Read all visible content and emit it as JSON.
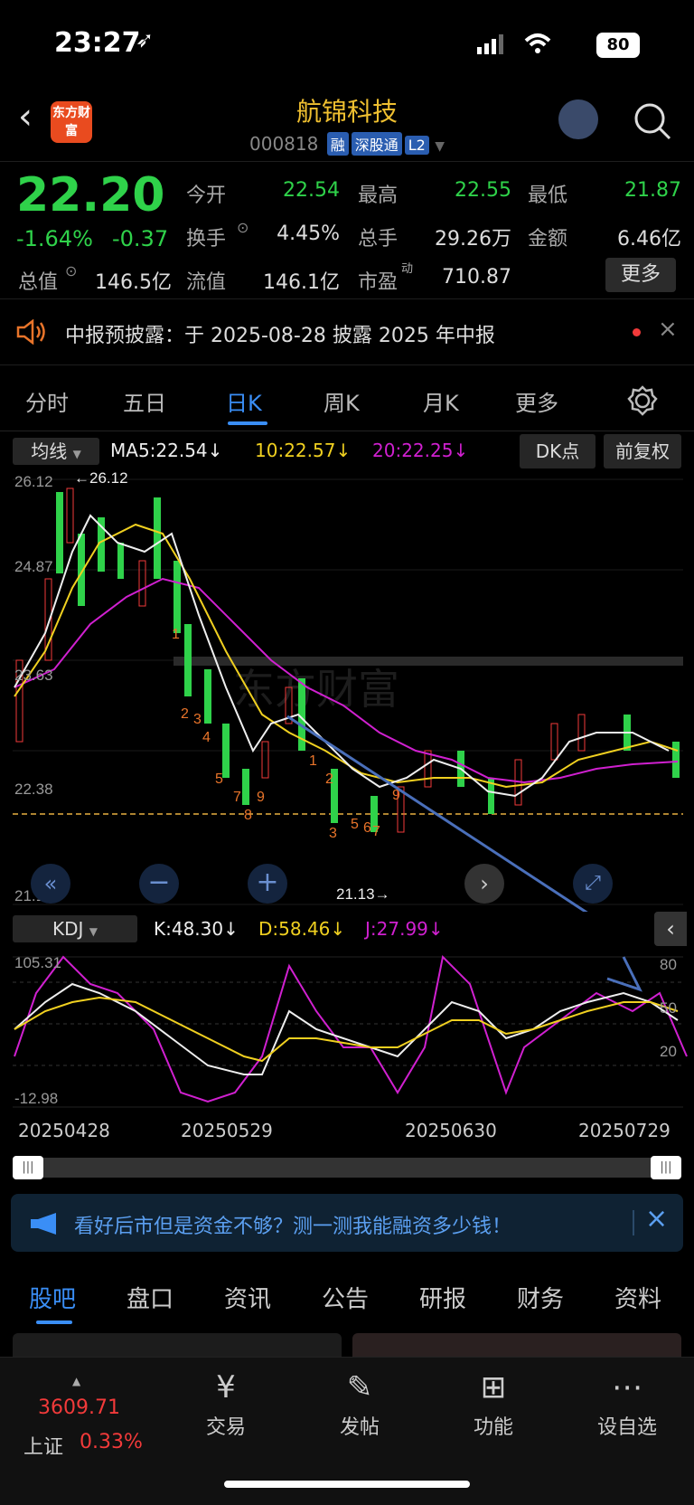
{
  "status": {
    "time": "23:27",
    "battery": "80"
  },
  "header": {
    "logo_text": "东方财富",
    "title": "航锦科技",
    "code": "000818",
    "tags": [
      "融",
      "深股通",
      "L2"
    ]
  },
  "quote": {
    "price": "22.20",
    "change_pct": "-1.64%",
    "change_abs": "-0.37",
    "fields": [
      {
        "label": "今开",
        "value": "22.54",
        "color": "#2fd24a"
      },
      {
        "label": "最高",
        "value": "22.55",
        "color": "#2fd24a"
      },
      {
        "label": "最低",
        "value": "21.87",
        "color": "#2fd24a"
      },
      {
        "label": "换手",
        "value": "4.45%",
        "color": "#dddddd"
      },
      {
        "label": "总手",
        "value": "29.26万",
        "color": "#dddddd"
      },
      {
        "label": "金额",
        "value": "6.46亿",
        "color": "#dddddd"
      },
      {
        "label": "总值",
        "value": "146.5亿",
        "color": "#dddddd"
      },
      {
        "label": "流值",
        "value": "146.1亿",
        "color": "#dddddd"
      },
      {
        "label": "市盈",
        "value": "710.87",
        "color": "#dddddd"
      }
    ],
    "pe_superscript": "动",
    "more_button": "更多"
  },
  "notice": {
    "text": "中报预披露：于 2025-08-28 披露 2025 年中报"
  },
  "tabs": [
    "分时",
    "五日",
    "日K",
    "周K",
    "月K",
    "更多"
  ],
  "ma_bar": {
    "selector": "均线",
    "ma5": "MA5:22.54↓",
    "ma10": "10:22.57↓",
    "ma20": "20:22.25↓",
    "dk_button": "DK点",
    "adjust_button": "前复权"
  },
  "kline": {
    "price_labels": [
      "26.12",
      "24.87",
      "23.63",
      "22.38",
      "21.13"
    ],
    "high_marker": "←26.12",
    "low_marker": "21.13→",
    "watermark": "东方财富"
  },
  "kdj_bar": {
    "selector": "KDJ",
    "k": "K:48.30↓",
    "d": "D:58.46↓",
    "j": "J:27.99↓"
  },
  "kdj": {
    "top_label": "105.31",
    "bottom_label": "-12.98",
    "right_labels": [
      "80",
      "50",
      "20"
    ]
  },
  "dates": [
    "20250428",
    "20250529",
    "20250630",
    "20250729"
  ],
  "banner": {
    "text": "看好后市但是资金不够？测一测我能融资多少钱！"
  },
  "bottom_tabs": [
    "股吧",
    "盘口",
    "资讯",
    "公告",
    "研报",
    "财务",
    "资料"
  ],
  "dock": {
    "index_value": "3609.71",
    "index_name": "上证",
    "index_change": "0.33%",
    "items": [
      "交易",
      "发帖",
      "功能",
      "设自选"
    ]
  },
  "colors": {
    "up": "#f23a3a",
    "down": "#2fd24a",
    "accent": "#3a8ef6",
    "ma10": "#f0d020",
    "ma20": "#d020d0"
  }
}
